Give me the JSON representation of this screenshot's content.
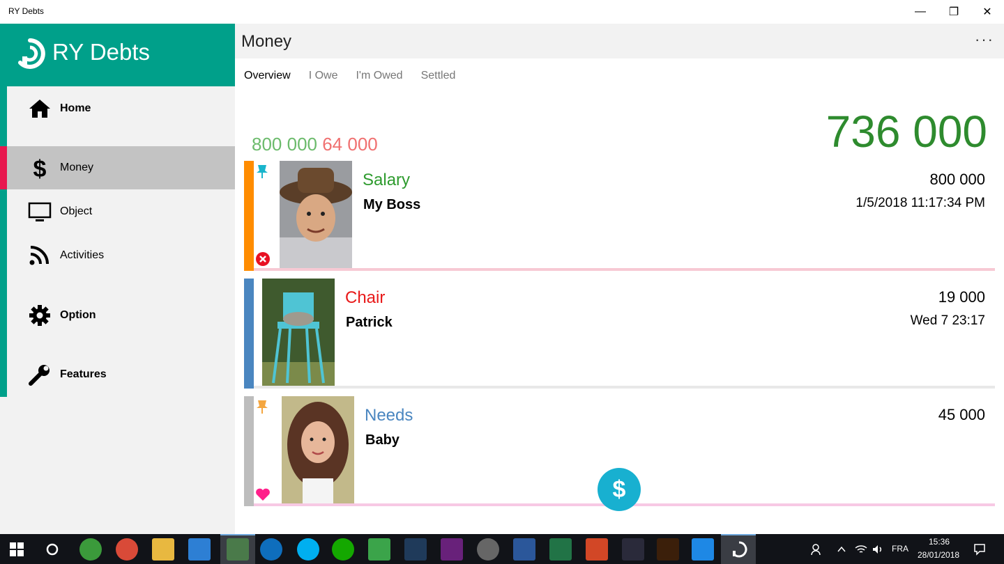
{
  "window": {
    "title": "RY Debts",
    "minimize": "—",
    "restore": "❐",
    "close": "✕"
  },
  "brand": {
    "name": "RY Debts"
  },
  "nav": [
    {
      "label": "Home",
      "icon": "home-icon"
    },
    {
      "label": "Money",
      "icon": "dollar-icon",
      "active": true
    },
    {
      "label": "Object",
      "icon": "monitor-icon"
    },
    {
      "label": "Activities",
      "icon": "rss-icon"
    },
    {
      "label": "Option",
      "icon": "gear-icon"
    },
    {
      "label": "Features",
      "icon": "wrench-icon"
    }
  ],
  "header": {
    "title": "Money",
    "more": "···"
  },
  "tabs": [
    {
      "label": "Overview",
      "active": true
    },
    {
      "label": "I Owe"
    },
    {
      "label": "I'm Owed"
    },
    {
      "label": "Settled"
    }
  ],
  "summary": {
    "total": "736 000",
    "owed_to_me": "800 000",
    "i_owe": "64 000"
  },
  "entries": [
    {
      "category": "Salary",
      "person": "My Boss",
      "amount": "800 000",
      "date": "1/5/2018 11:17:34 PM",
      "bar_color": "#ff8c00",
      "category_color": "#2e9b2e",
      "pin": "cyan",
      "badge": "remove-icon"
    },
    {
      "category": "Chair",
      "person": "Patrick",
      "amount": "19 000",
      "date": "Wed 7 23:17",
      "bar_color": "#4a86c0",
      "category_color": "#e81818"
    },
    {
      "category": "Needs",
      "person": "Baby",
      "amount": "45 000",
      "date": "",
      "bar_color": "#bdbdbd",
      "category_color": "#4a86c0",
      "pin": "orange",
      "badge": "heart-icon"
    }
  ],
  "fab": {
    "label": "$"
  },
  "taskbar": {
    "language": "FRA",
    "time": "15:36",
    "date": "28/01/2018"
  }
}
